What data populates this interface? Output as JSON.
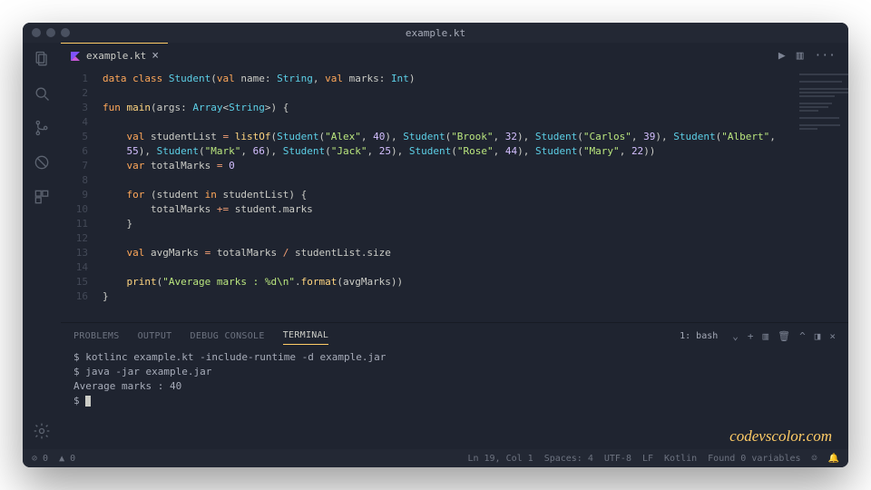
{
  "window_title": "example.kt",
  "tab": {
    "label": "example.kt",
    "icon": "kotlin"
  },
  "editor_actions": {
    "run": "▶",
    "split": "▥",
    "more": "···"
  },
  "code": {
    "lines": [
      {
        "n": 1,
        "html": "<span class='kw'>data class</span> <span class='type'>Student</span>(<span class='kw'>val</span> name: <span class='type'>String</span>, <span class='kw'>val</span> marks: <span class='type'>Int</span>)"
      },
      {
        "n": 2,
        "html": ""
      },
      {
        "n": 3,
        "html": "<span class='kw'>fun</span> <span class='fn'>main</span>(args: <span class='type'>Array</span>&lt;<span class='type'>String</span>&gt;) {"
      },
      {
        "n": 4,
        "html": ""
      },
      {
        "n": 5,
        "html": "    <span class='kw'>val</span> studentList <span class='op'>=</span> <span class='fn'>listOf</span>(<span class='type'>Student</span>(<span class='str'>\"Alex\"</span>, <span class='num'>40</span>), <span class='type'>Student</span>(<span class='str'>\"Brook\"</span>, <span class='num'>32</span>), <span class='type'>Student</span>(<span class='str'>\"Carlos\"</span>, <span class='num'>39</span>), <span class='type'>Student</span>(<span class='str'>\"Albert\"</span>,"
      },
      {
        "n": 6,
        "html": "    <span class='num'>55</span>), <span class='type'>Student</span>(<span class='str'>\"Mark\"</span>, <span class='num'>66</span>), <span class='type'>Student</span>(<span class='str'>\"Jack\"</span>, <span class='num'>25</span>), <span class='type'>Student</span>(<span class='str'>\"Rose\"</span>, <span class='num'>44</span>), <span class='type'>Student</span>(<span class='str'>\"Mary\"</span>, <span class='num'>22</span>))"
      },
      {
        "n": 7,
        "html": "    <span class='kw'>var</span> totalMarks <span class='op'>=</span> <span class='num'>0</span>"
      },
      {
        "n": 8,
        "html": ""
      },
      {
        "n": 9,
        "html": "    <span class='kw'>for</span> (student <span class='kw'>in</span> studentList) {"
      },
      {
        "n": 10,
        "html": "        totalMarks <span class='op'>+=</span> student.marks"
      },
      {
        "n": 11,
        "html": "    }"
      },
      {
        "n": 12,
        "html": ""
      },
      {
        "n": 13,
        "html": "    <span class='kw'>val</span> avgMarks <span class='op'>=</span> totalMarks <span class='op'>/</span> studentList.size"
      },
      {
        "n": 14,
        "html": ""
      },
      {
        "n": 15,
        "html": "    <span class='fn'>print</span>(<span class='str'>\"Average marks : %d\\n\"</span>.<span class='fn'>format</span>(avgMarks))"
      },
      {
        "n": 16,
        "html": "}"
      }
    ]
  },
  "panel": {
    "tabs": [
      "PROBLEMS",
      "OUTPUT",
      "DEBUG CONSOLE",
      "TERMINAL"
    ],
    "active": "TERMINAL",
    "dropdown": "1: bash",
    "terminal_lines": [
      "$ kotlinc example.kt -include-runtime -d example.jar",
      "$ java -jar example.jar",
      "Average marks : 40",
      "$ "
    ]
  },
  "status": {
    "errors": "⊘ 0",
    "warnings": "▲ 0",
    "cursor": "Ln 19, Col 1",
    "spaces": "Spaces: 4",
    "encoding": "UTF-8",
    "eol": "LF",
    "lang": "Kotlin",
    "vars": "Found 0 variables",
    "smile": "☺",
    "bell": "🔔"
  },
  "watermark": "codevscolor.com"
}
